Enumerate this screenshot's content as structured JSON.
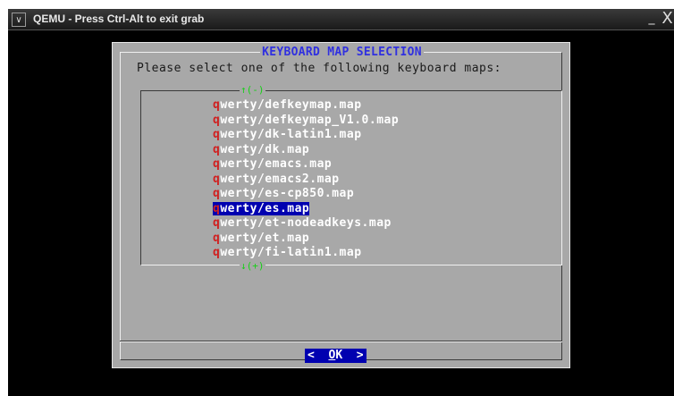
{
  "window": {
    "title": "QEMU - Press Ctrl-Alt to exit grab",
    "menu_glyph": "∨",
    "minimize_glyph": "_",
    "close_glyph": "X"
  },
  "dialog": {
    "title": "KEYBOARD MAP SELECTION",
    "prompt": "Please select one of the following keyboard maps:",
    "scroll_up_indicator": "↑(-)",
    "scroll_down_indicator": "↓(+)",
    "items": [
      {
        "hotkey": "q",
        "rest": "werty/defkeymap.map",
        "selected": false
      },
      {
        "hotkey": "q",
        "rest": "werty/defkeymap_V1.0.map",
        "selected": false
      },
      {
        "hotkey": "q",
        "rest": "werty/dk-latin1.map",
        "selected": false
      },
      {
        "hotkey": "q",
        "rest": "werty/dk.map",
        "selected": false
      },
      {
        "hotkey": "q",
        "rest": "werty/emacs.map",
        "selected": false
      },
      {
        "hotkey": "q",
        "rest": "werty/emacs2.map",
        "selected": false
      },
      {
        "hotkey": "q",
        "rest": "werty/es-cp850.map",
        "selected": false
      },
      {
        "hotkey": "q",
        "rest": "werty/es.map",
        "selected": true
      },
      {
        "hotkey": "q",
        "rest": "werty/et-nodeadkeys.map",
        "selected": false
      },
      {
        "hotkey": "q",
        "rest": "werty/et.map",
        "selected": false
      },
      {
        "hotkey": "q",
        "rest": "werty/fi-latin1.map",
        "selected": false
      }
    ],
    "ok_button": {
      "left": "<  ",
      "hotkey": "O",
      "rest": "K",
      "right": "  >"
    }
  },
  "colors": {
    "dialog_bg": "#a8a8a8",
    "title": "#3030e0",
    "selection": "#0000b0",
    "hotkey": "#d02020",
    "scroll_indicator": "#18d018"
  }
}
